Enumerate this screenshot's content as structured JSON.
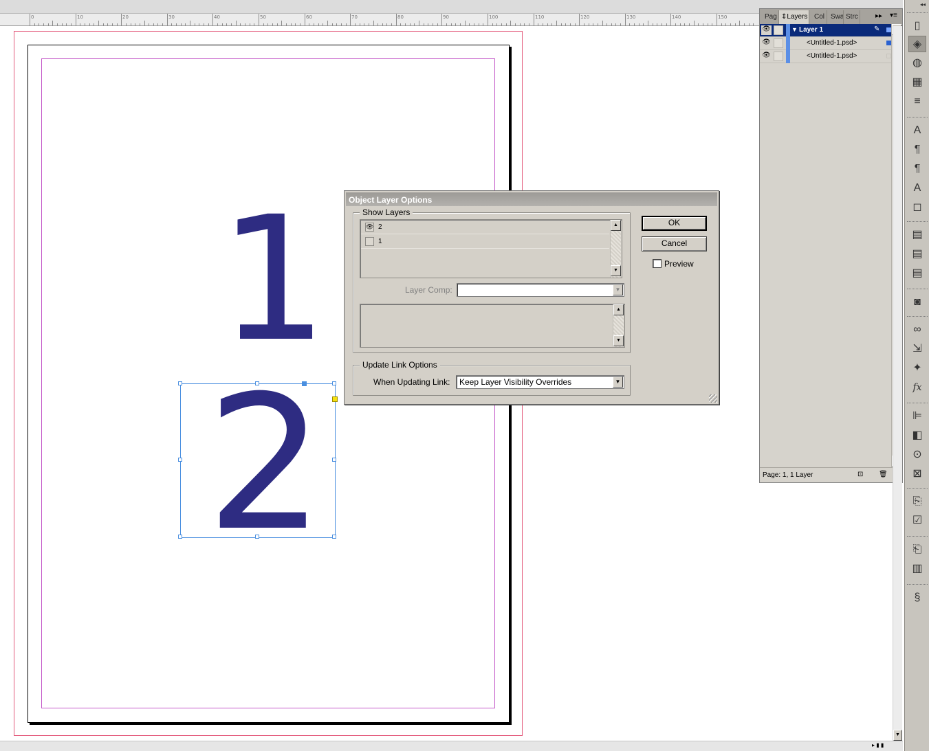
{
  "ruler": {
    "labels": [
      "0",
      "10",
      "20",
      "30",
      "40",
      "50",
      "60",
      "70",
      "80",
      "90",
      "100",
      "110",
      "120",
      "130",
      "140",
      "150"
    ]
  },
  "document": {
    "number_top": "1",
    "number_bottom": "2"
  },
  "dialog": {
    "title": "Object Layer Options",
    "show_layers_label": "Show Layers",
    "layers": [
      {
        "name": "2",
        "visible": true
      },
      {
        "name": "1",
        "visible": false
      }
    ],
    "layer_comp_label": "Layer Comp:",
    "layer_comp_value": "",
    "update_link_label": "Update Link Options",
    "when_updating_label": "When Updating Link:",
    "when_updating_value": "Keep Layer Visibility Overrides",
    "ok_label": "OK",
    "cancel_label": "Cancel",
    "preview_label": "Preview",
    "preview_checked": false
  },
  "layers_panel": {
    "tabs": [
      "Pag",
      "Layers",
      "Col",
      "Swa",
      "Strc"
    ],
    "active_tab": "Layers",
    "rows": [
      {
        "name": "Layer 1",
        "type": "layer"
      },
      {
        "name": "<Untitled-1.psd>",
        "type": "item"
      },
      {
        "name": "<Untitled-1.psd>",
        "type": "item"
      }
    ],
    "footer": "Page: 1, 1 Layer",
    "layer_color": "#5b8fe6"
  },
  "tool_strip": {
    "icons": [
      "pages-icon",
      "layers-icon",
      "swatches-icon",
      "grid-icon",
      "stroke-icon",
      "character-icon",
      "paragraph-icon",
      "paragraph-styles-icon",
      "character-styles-icon",
      "object-styles-icon",
      "cell-styles-icon",
      "table-styles-icon",
      "table-icon",
      "effects-panel-icon",
      "links-icon",
      "text-wrap-icon",
      "gradient-icon",
      "fx-icon",
      "align-icon",
      "pathfinder-icon",
      "transform-icon",
      "color-icon",
      "hyperlinks-icon",
      "preflight-icon",
      "index-icon",
      "book-icon",
      "script-icon"
    ]
  }
}
